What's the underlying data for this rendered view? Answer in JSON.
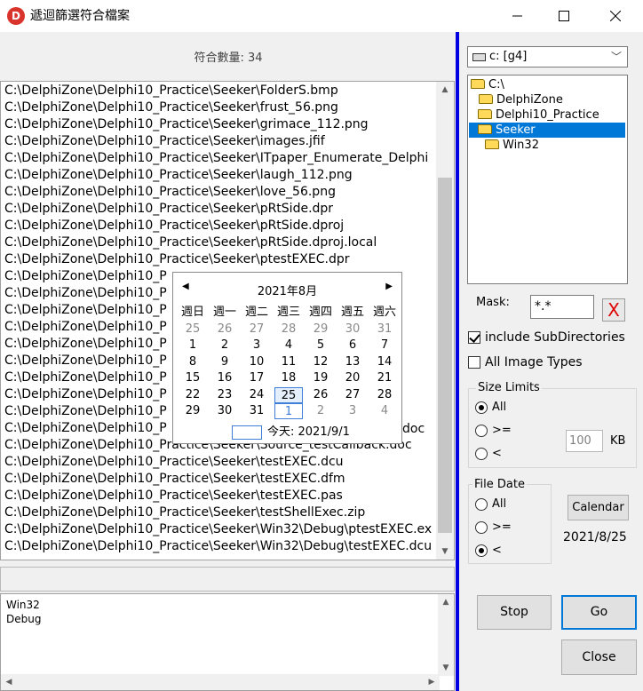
{
  "window": {
    "title": "遞迴篩選符合檔案",
    "app_icon_letter": "D",
    "minimize_icon": "minimize-icon",
    "maximize_icon": "maximize-icon",
    "close_icon": "close-icon"
  },
  "results": {
    "count_label": "符合數量: 34",
    "files": [
      "C:\\DelphiZone\\Delphi10_Practice\\Seeker\\FolderS.bmp",
      "C:\\DelphiZone\\Delphi10_Practice\\Seeker\\frust_56.png",
      "C:\\DelphiZone\\Delphi10_Practice\\Seeker\\grimace_112.png",
      "C:\\DelphiZone\\Delphi10_Practice\\Seeker\\images.jfif",
      "C:\\DelphiZone\\Delphi10_Practice\\Seeker\\ITpaper_Enumerate_Delphi",
      "C:\\DelphiZone\\Delphi10_Practice\\Seeker\\laugh_112.png",
      "C:\\DelphiZone\\Delphi10_Practice\\Seeker\\love_56.png",
      "C:\\DelphiZone\\Delphi10_Practice\\Seeker\\pRtSide.dpr",
      "C:\\DelphiZone\\Delphi10_Practice\\Seeker\\pRtSide.dproj",
      "C:\\DelphiZone\\Delphi10_Practice\\Seeker\\pRtSide.dproj.local",
      "C:\\DelphiZone\\Delphi10_Practice\\Seeker\\ptestEXEC.dpr",
      "C:\\DelphiZone\\Delphi10_P",
      "C:\\DelphiZone\\Delphi10_P",
      "C:\\DelphiZone\\Delphi10_P",
      "C:\\DelphiZone\\Delphi10_P",
      "C:\\DelphiZone\\Delphi10_P",
      "C:\\DelphiZone\\Delphi10_P",
      "C:\\DelphiZone\\Delphi10_P",
      "C:\\DelphiZone\\Delphi10_P",
      "C:\\DelphiZone\\Delphi10_P",
      "C:\\DelphiZone\\Delphi10_P",
      "C:\\DelphiZone\\Delphi10_Practice\\Seeker\\Source_testCallback.doc",
      "C:\\DelphiZone\\Delphi10_Practice\\Seeker\\testEXEC.dcu",
      "C:\\DelphiZone\\Delphi10_Practice\\Seeker\\testEXEC.dfm",
      "C:\\DelphiZone\\Delphi10_Practice\\Seeker\\testEXEC.pas",
      "C:\\DelphiZone\\Delphi10_Practice\\Seeker\\testShellExec.zip",
      "C:\\DelphiZone\\Delphi10_Practice\\Seeker\\Win32\\Debug\\ptestEXEC.ex",
      "C:\\DelphiZone\\Delphi10_Practice\\Seeker\\Win32\\Debug\\testEXEC.dcu"
    ],
    "overlap_fragment_1": "doc"
  },
  "log": {
    "lines": [
      "Win32",
      "Debug"
    ]
  },
  "drive": {
    "selected": "c: [g4]"
  },
  "dirs": [
    {
      "label": "C:\\",
      "indent": 0
    },
    {
      "label": "DelphiZone",
      "indent": 1
    },
    {
      "label": "Delphi10_Practice",
      "indent": 2
    },
    {
      "label": "Seeker",
      "indent": 3,
      "selected": true
    },
    {
      "label": "Win32",
      "indent": 4
    }
  ],
  "mask": {
    "label": "Mask:",
    "value": "*.*",
    "clear_label": "X"
  },
  "options": {
    "include_subdirs": "include SubDirectories",
    "include_subdirs_checked": true,
    "all_image_types": "All Image Types",
    "all_image_types_checked": false
  },
  "size_limits": {
    "title": "Size Limits",
    "opt_all": "All",
    "opt_ge": ">=",
    "opt_lt": "<",
    "selected": "All",
    "value": "100",
    "unit": "KB"
  },
  "file_date": {
    "title": "File Date",
    "opt_all": "All",
    "opt_ge": ">=",
    "opt_lt": "<",
    "selected": "<",
    "calendar_button": "Calendar",
    "date_value": "2021/8/25"
  },
  "buttons": {
    "stop": "Stop",
    "go": "Go",
    "close": "Close"
  },
  "calendar": {
    "month_title": "2021年8月",
    "weekdays": [
      "週日",
      "週一",
      "週二",
      "週三",
      "週四",
      "週五",
      "週六"
    ],
    "weeks": [
      [
        "25",
        "26",
        "27",
        "28",
        "29",
        "30",
        "31"
      ],
      [
        "1",
        "2",
        "3",
        "4",
        "5",
        "6",
        "7"
      ],
      [
        "8",
        "9",
        "10",
        "11",
        "12",
        "13",
        "14"
      ],
      [
        "15",
        "16",
        "17",
        "18",
        "19",
        "20",
        "21"
      ],
      [
        "22",
        "23",
        "24",
        "25",
        "26",
        "27",
        "28"
      ],
      [
        "29",
        "30",
        "31",
        "1",
        "2",
        "3",
        "4"
      ]
    ],
    "today_label": "今天: 2021/9/1",
    "selected_day": "25",
    "today_day": "1"
  }
}
